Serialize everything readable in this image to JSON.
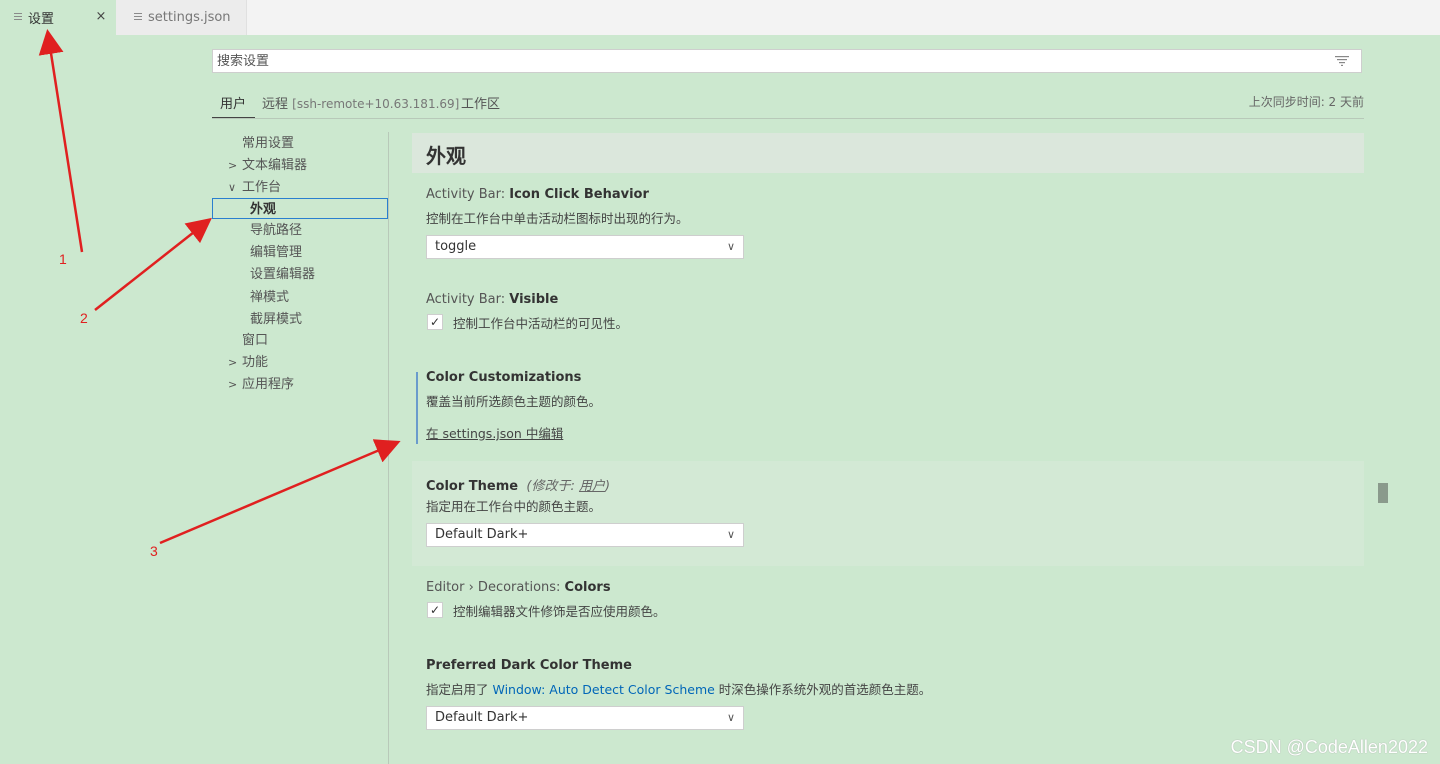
{
  "tabs": {
    "active": {
      "label": "设置",
      "close": "×"
    },
    "inactive": {
      "label": "settings.json"
    }
  },
  "search": {
    "placeholder": "搜索设置"
  },
  "scopes": {
    "user": "用户",
    "remote": "远程",
    "remote_host": "[ssh-remote+10.63.181.69]",
    "workspace": "工作区",
    "sync": "上次同步时间: 2 天前"
  },
  "toc": {
    "common": "常用设置",
    "text_editor": "文本编辑器",
    "workbench": "工作台",
    "appearance": "外观",
    "breadcrumbs": "导航路径",
    "editor_management": "编辑管理",
    "settings_editor": "设置编辑器",
    "zen_mode": "禅模式",
    "screencast_mode": "截屏模式",
    "window": "窗口",
    "features": "功能",
    "application": "应用程序"
  },
  "section": {
    "title": "外观"
  },
  "settings": {
    "icon_click": {
      "category": "Activity Bar: ",
      "name": "Icon Click Behavior",
      "desc": "控制在工作台中单击活动栏图标时出现的行为。",
      "value": "toggle"
    },
    "visible": {
      "category": "Activity Bar: ",
      "name": "Visible",
      "desc": "控制工作台中活动栏的可见性。",
      "checked": "✓"
    },
    "color_custom": {
      "name": "Color Customizations",
      "desc": "覆盖当前所选颜色主题的颜色。",
      "link": "在 settings.json 中编辑"
    },
    "color_theme": {
      "name": "Color Theme",
      "modified_prefix": "(修改于: ",
      "modified_scope": "用户",
      "modified_suffix": ")",
      "desc": "指定用在工作台中的颜色主题。",
      "value": "Default Dark+"
    },
    "decorations": {
      "category": "Editor › Decorations: ",
      "name": "Colors",
      "desc": "控制编辑器文件修饰是否应使用颜色。",
      "checked": "✓"
    },
    "preferred_dark": {
      "name": "Preferred Dark Color Theme",
      "desc_prefix": "指定启用了 ",
      "desc_link": "Window: Auto Detect Color Scheme",
      "desc_suffix": " 时深色操作系统外观的首选颜色主题。",
      "value": "Default Dark+"
    }
  },
  "annotations": {
    "one": "1",
    "two": "2",
    "three": "3"
  },
  "watermark": "CSDN @CodeAllen2022",
  "colors": {
    "background": "#cce8cf",
    "accent": "#0066b8",
    "annotation": "#e02020"
  }
}
